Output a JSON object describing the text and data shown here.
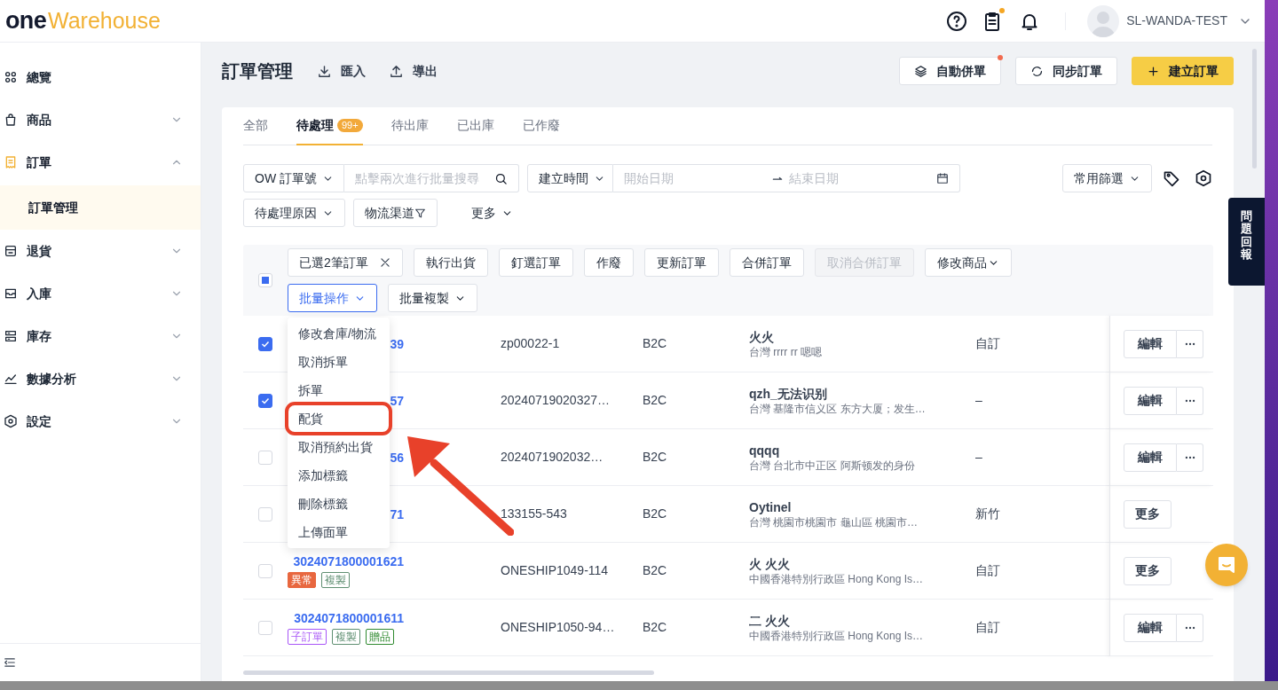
{
  "header": {
    "logo_dark": "one",
    "logo_accent": "Warehouse",
    "clipboard_dot": true,
    "user": "SL-WANDA-TEST"
  },
  "sidebar": {
    "items": [
      {
        "label": "總覽",
        "active": false
      },
      {
        "label": "商品",
        "active": false,
        "expanded": false
      },
      {
        "label": "訂單",
        "active": true,
        "expanded": true,
        "children": [
          {
            "label": "訂單管理",
            "selected": true
          }
        ]
      },
      {
        "label": "退貨",
        "active": false,
        "expanded": false
      },
      {
        "label": "入庫",
        "active": false,
        "expanded": false
      },
      {
        "label": "庫存",
        "active": false,
        "expanded": false
      },
      {
        "label": "數據分析",
        "active": false,
        "expanded": false
      },
      {
        "label": "設定",
        "active": false,
        "expanded": false
      }
    ]
  },
  "page": {
    "title": "訂單管理",
    "links": [
      "匯入",
      "導出"
    ],
    "buttons": [
      {
        "label": "自動併單",
        "kind": "default",
        "dot": true
      },
      {
        "label": "同步訂單",
        "kind": "default",
        "dot": false
      },
      {
        "label": "建立訂單",
        "kind": "primary",
        "dot": false
      }
    ]
  },
  "tabs": [
    {
      "label": "全部",
      "selected": false
    },
    {
      "label": "待處理",
      "selected": true,
      "badge": "99+"
    },
    {
      "label": "待出庫",
      "selected": false
    },
    {
      "label": "已出庫",
      "selected": false
    },
    {
      "label": "已作廢",
      "selected": false
    }
  ],
  "filters": {
    "order_field": "OW 訂單號",
    "search_placeholder": "點擊兩次進行批量搜尋",
    "date_field": "建立時間",
    "start_placeholder": "開始日期",
    "end_placeholder": "結束日期",
    "saved": "常用篩選",
    "reason": "待處理原因",
    "channel": "物流渠道",
    "more": "更多"
  },
  "bulk": {
    "select_all_partial": true,
    "selection": "已選2筆訂單",
    "actions": [
      {
        "label": "執行出貨",
        "disabled": false,
        "dropdown": false
      },
      {
        "label": "釘選訂單",
        "disabled": false,
        "dropdown": false
      },
      {
        "label": "作廢",
        "disabled": false,
        "dropdown": false
      },
      {
        "label": "更新訂單",
        "disabled": false,
        "dropdown": false
      },
      {
        "label": "合併訂單",
        "disabled": false,
        "dropdown": false
      },
      {
        "label": "取消合併訂單",
        "disabled": true,
        "dropdown": false
      },
      {
        "label": "修改商品",
        "disabled": false,
        "dropdown": true
      }
    ],
    "dropdowns": [
      {
        "label": "批量操作",
        "expanded": true,
        "menu": [
          {
            "label": "修改倉庫/物流",
            "highlighted": false
          },
          {
            "label": "取消拆單",
            "highlighted": false
          },
          {
            "label": "拆單",
            "highlighted": false
          },
          {
            "label": "配貨",
            "highlighted": true
          },
          {
            "label": "取消預約出貨",
            "highlighted": false
          },
          {
            "label": "添加標籤",
            "highlighted": false
          },
          {
            "label": "刪除標籤",
            "highlighted": false
          },
          {
            "label": "上傳面單",
            "highlighted": false
          }
        ]
      },
      {
        "label": "批量複製",
        "expanded": false
      }
    ]
  },
  "rows": [
    {
      "checked": true,
      "order_no": "39",
      "ref_no": "zp00022-1",
      "type": "B2C",
      "recipient": "火火",
      "address": "台灣 rrrr rr 嗯嗯",
      "column_6": "自訂",
      "kind": "edit",
      "action_label": "編輯"
    },
    {
      "checked": true,
      "order_no": "57",
      "ref_no": "20240719020327…",
      "type": "B2C",
      "recipient": "qzh_无法识别",
      "address": "台灣 基隆市信义区 东方大厦；发生…",
      "column_6": "–",
      "kind": "edit",
      "action_label": "編輯"
    },
    {
      "checked": false,
      "order_no": "56",
      "ref_no": "2024071902032…",
      "type": "B2C",
      "recipient": "qqqq",
      "address": "台灣 台北市中正区 阿斯顿发的身份",
      "column_6": "–",
      "kind": "edit",
      "action_label": "編輯"
    },
    {
      "checked": false,
      "order_no": "71",
      "ref_no": "133155-543",
      "type": "B2C",
      "recipient": "Oytinel",
      "address": "台灣 桃園市桃園市 龜山區 桃園市…",
      "column_6": "新竹",
      "kind": "more",
      "action_label": "更多"
    },
    {
      "checked": false,
      "order_no": "3024071800001621",
      "tags": [
        {
          "label": "異常",
          "kind": "solid",
          "color": "#e8673f"
        },
        {
          "label": "複製",
          "kind": "outline",
          "color": "#5f8f72"
        }
      ],
      "ref_no": "ONESHIP1049-114",
      "type": "B2C",
      "recipient": "火 火火",
      "address": "中國香港特別行政區 Hong Kong Is…",
      "column_6": "自訂",
      "kind": "more",
      "action_label": "更多"
    },
    {
      "checked": false,
      "order_no": "3024071800001611",
      "tags": [
        {
          "label": "子訂單",
          "kind": "outline",
          "color": "#a855f7"
        },
        {
          "label": "複製",
          "kind": "outline",
          "color": "#5f8f72"
        },
        {
          "label": "贈品",
          "kind": "outline",
          "color": "#2f8a2f"
        }
      ],
      "ref_no": "ONESHIP1050-94…",
      "type": "B2C",
      "recipient": "二 火火",
      "address": "中國香港特別行政區 Hong Kong Is…",
      "column_6": "自訂",
      "kind": "edit",
      "action_label": "編輯"
    }
  ],
  "feedback_tab": "問題回報"
}
